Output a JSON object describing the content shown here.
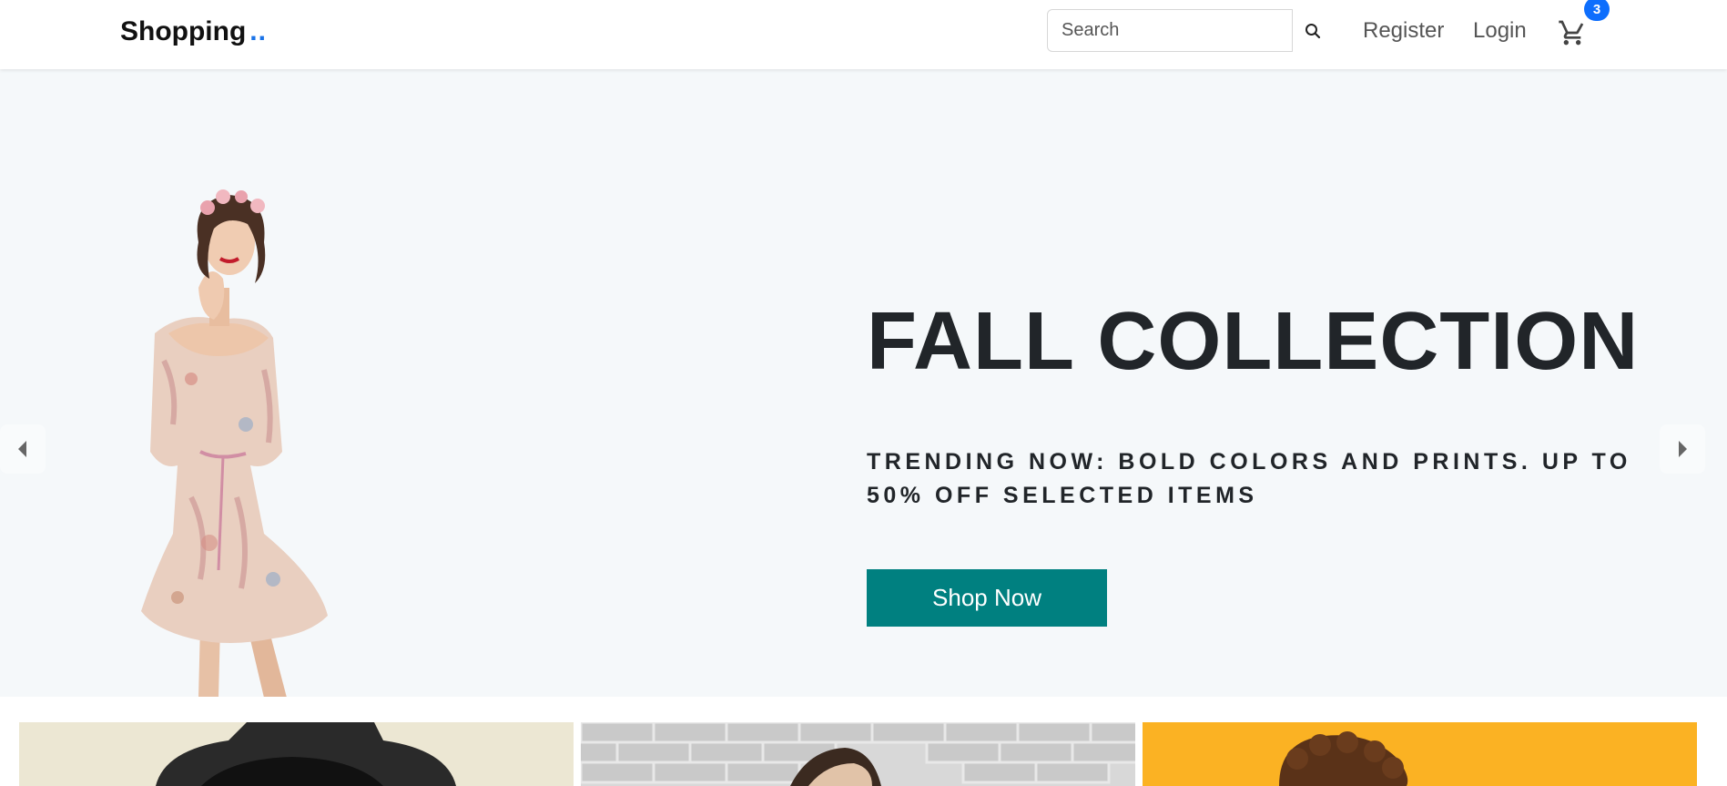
{
  "navbar": {
    "brand": "Shopping",
    "brand_dots": "..",
    "search_placeholder": "Search",
    "register_label": "Register",
    "login_label": "Login",
    "cart_count": "3"
  },
  "hero": {
    "title": "FALL COLLECTION",
    "subtitle": "TRENDING NOW: BOLD COLORS AND PRINTS. UP TO 50% OFF SELECTED ITEMS",
    "cta_label": "Shop Now"
  },
  "colors": {
    "accent": "#008080",
    "badge": "#0d6efd",
    "hero_bg": "#f5f8fa",
    "brand_dots": "#1a73e8"
  },
  "icons": {
    "search": "search-icon",
    "cart": "cart-icon",
    "prev": "caret-left-icon",
    "next": "caret-right-icon"
  }
}
